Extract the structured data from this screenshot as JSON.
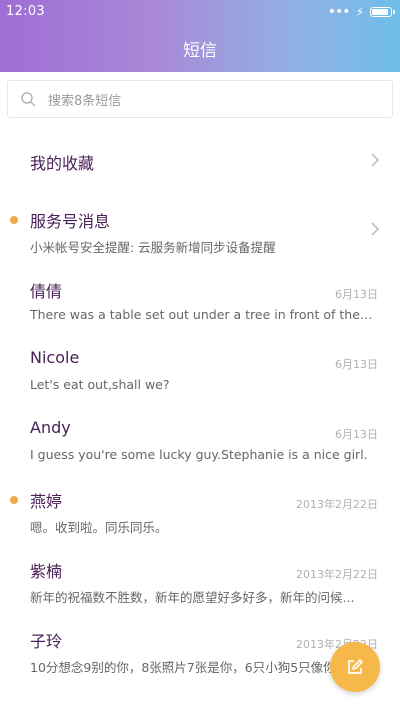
{
  "status_bar": {
    "time": "12:03",
    "signal_dots": "•••",
    "charging": "⚡",
    "battery_level": 1.0
  },
  "header": {
    "title": "短信"
  },
  "search": {
    "placeholder": "搜索8条短信",
    "icon": "search-icon"
  },
  "favorites": {
    "label": "我的收藏",
    "icon": "chevron-right-icon"
  },
  "service": {
    "title": "服务号消息",
    "preview": "小米帐号安全提醒: 云服务新增同步设备提醒",
    "unread": true,
    "icon": "chevron-right-icon"
  },
  "messages": [
    {
      "name": "倩倩",
      "preview": "There was a table set out under a tree in front of the ho...",
      "date": "6月13日",
      "unread": false
    },
    {
      "name": "Nicole",
      "preview": "Let's eat out,shall we?",
      "date": "6月13日",
      "unread": false
    },
    {
      "name": "Andy",
      "preview": "I guess you're some lucky guy.Stephanie is a nice girl.",
      "date": "6月13日",
      "unread": false
    },
    {
      "name": "燕婷",
      "preview": "嗯。收到啦。同乐同乐。",
      "date": "2013年2月22日",
      "unread": true
    },
    {
      "name": "紫楠",
      "preview": "新年的祝福数不胜数，新年的愿望好多好多，新年的问候...",
      "date": "2013年2月22日",
      "unread": false
    },
    {
      "name": "子玲",
      "preview": "10分想念9别的你，8张照片7张是你，6只小狗5只像你",
      "date": "2013年2月22日",
      "unread": false
    }
  ],
  "fab": {
    "icon": "compose-icon"
  },
  "colors": {
    "accent": "#f7b84b",
    "title_text": "#4a2057",
    "unread_dot": "#f2a94a"
  }
}
